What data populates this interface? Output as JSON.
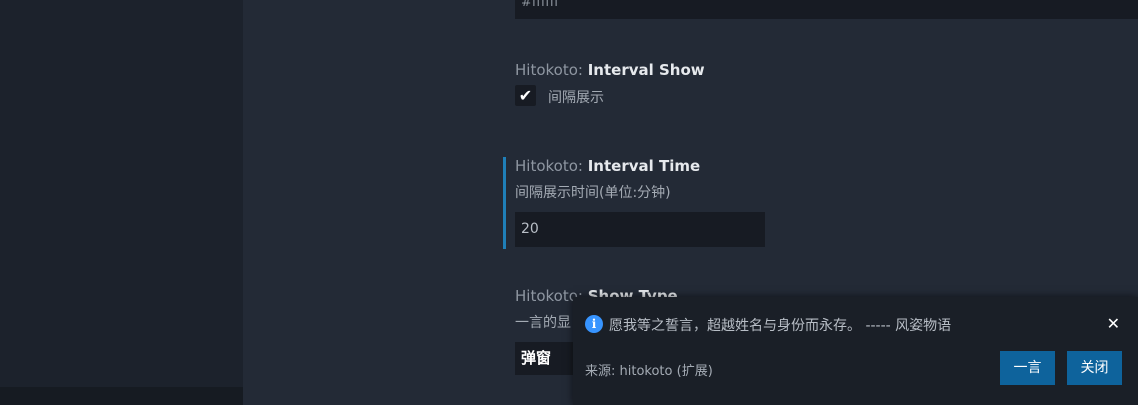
{
  "color_field": {
    "value": "#ffffff"
  },
  "interval_show": {
    "prefix": "Hitokoto: ",
    "name": "Interval Show",
    "description": "间隔展示",
    "checked_glyph": "✔"
  },
  "interval_time": {
    "prefix": "Hitokoto: ",
    "name": "Interval Time",
    "description": "间隔展示时间(单位:分钟)",
    "value": "20"
  },
  "show_type": {
    "prefix": "Hitokoto: ",
    "name": "Show Type",
    "description": "一言的显",
    "selected": "弹窗"
  },
  "notification": {
    "icon": "info-icon",
    "icon_glyph": "i",
    "message": "愿我等之誓言，超越姓名与身份而永存。 ----- 风姿物语",
    "source": "来源: hitokoto (扩展)",
    "close_glyph": "✕",
    "buttons": {
      "primary": "一言",
      "secondary": "关闭"
    }
  },
  "colors": {
    "accent": "#0e639c",
    "focus_bar": "#1f7fb8",
    "info": "#3794ff"
  }
}
